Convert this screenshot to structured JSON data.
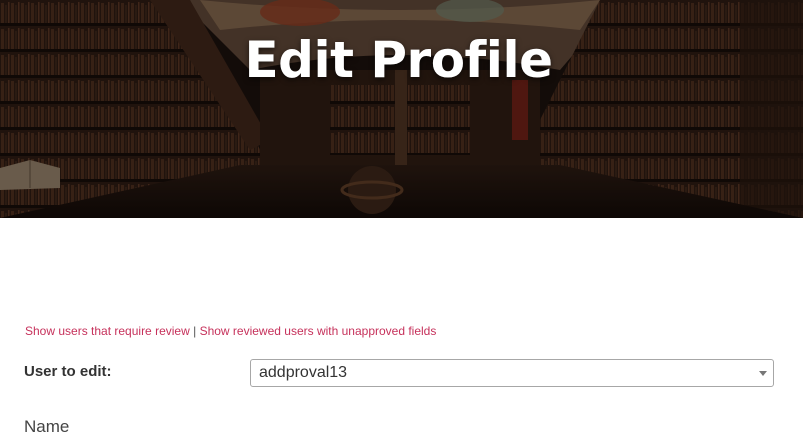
{
  "hero": {
    "title": "Edit Profile"
  },
  "review_links": {
    "require_review": "Show users that require review",
    "separator": "|",
    "reviewed_unapproved": "Show reviewed users with unapproved fields"
  },
  "user_select": {
    "label": "User to edit:",
    "value": "addproval13"
  },
  "name_field": {
    "label": "Name"
  },
  "colors": {
    "link": "#c6315b",
    "hero_dark": "#1c120e"
  },
  "icons": [
    "chevron-down-icon"
  ]
}
